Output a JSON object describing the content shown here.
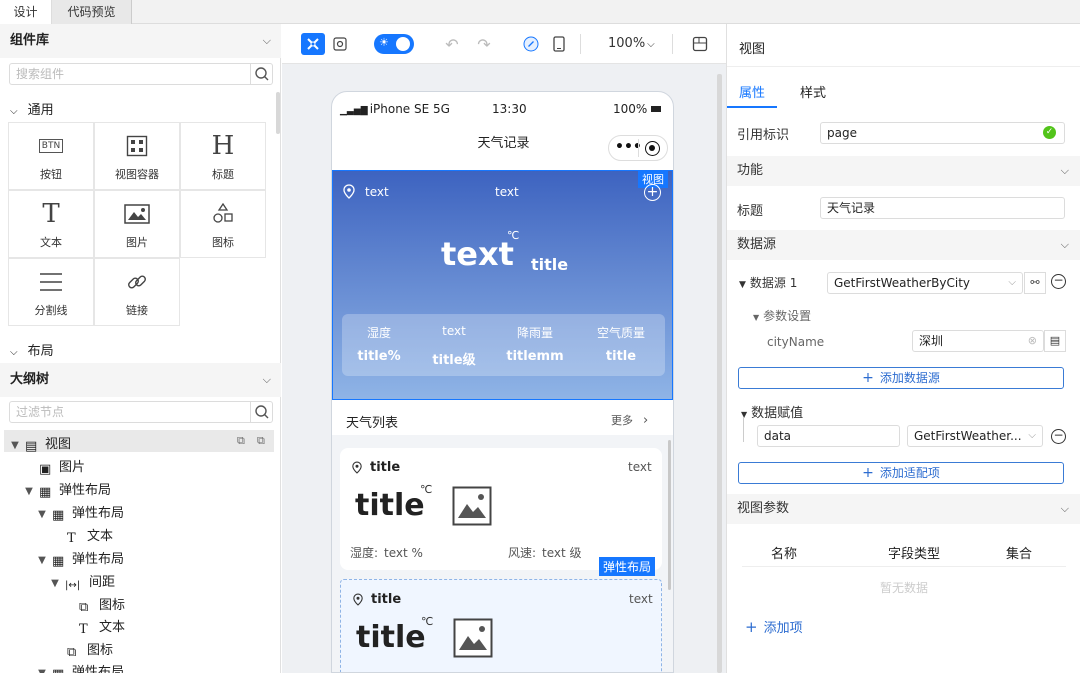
{
  "tabs": [
    {
      "label": "设计"
    },
    {
      "label": "代码预览"
    }
  ],
  "component_lib": {
    "title": "组件库",
    "search_placeholder": "搜索组件",
    "group_common": "通用",
    "group_layout": "布局",
    "items": [
      {
        "label": "按钮",
        "icon": "button-icon",
        "glyph": "BTN"
      },
      {
        "label": "视图容器",
        "icon": "view-container-icon",
        "glyph": "⊞"
      },
      {
        "label": "标题",
        "icon": "heading-icon",
        "glyph": "H"
      },
      {
        "label": "文本",
        "icon": "text-icon",
        "glyph": "T"
      },
      {
        "label": "图片",
        "icon": "image-icon",
        "glyph": "▣"
      },
      {
        "label": "图标",
        "icon": "shapes-icon",
        "glyph": "⧉"
      },
      {
        "label": "分割线",
        "icon": "divider-icon",
        "glyph": "☰"
      },
      {
        "label": "链接",
        "icon": "link-icon",
        "glyph": "🔗"
      }
    ]
  },
  "outline": {
    "title": "大纲树",
    "filter_placeholder": "过滤节点",
    "nodes": [
      {
        "label": "视图",
        "arrow": "▼",
        "glyph": "▤",
        "icon": "view-node-icon"
      },
      {
        "label": "图片",
        "arrow": "",
        "glyph": "▣",
        "icon": "image-node-icon"
      },
      {
        "label": "弹性布局",
        "arrow": "▼",
        "glyph": "▦",
        "icon": "flex-node-icon"
      },
      {
        "label": "弹性布局",
        "arrow": "▼",
        "glyph": "▦",
        "icon": "flex-node-icon"
      },
      {
        "label": "文本",
        "arrow": "",
        "glyph": "T",
        "icon": "text-node-icon"
      },
      {
        "label": "弹性布局",
        "arrow": "▼",
        "glyph": "▦",
        "icon": "flex-node-icon"
      },
      {
        "label": "间距",
        "arrow": "▼",
        "glyph": "|↔|",
        "icon": "spacing-node-icon"
      },
      {
        "label": "图标",
        "arrow": "",
        "glyph": "⧉",
        "icon": "icon-node-icon"
      },
      {
        "label": "文本",
        "arrow": "",
        "glyph": "T",
        "icon": "text-node-icon"
      },
      {
        "label": "图标",
        "arrow": "",
        "glyph": "⧉",
        "icon": "icon-node-icon"
      },
      {
        "label": "弹性布局",
        "arrow": "▼",
        "glyph": "▦",
        "icon": "flex-node-icon"
      }
    ]
  },
  "toolbar": {
    "zoom": "100%"
  },
  "phone": {
    "carrier": "iPhone SE 5G",
    "time": "13:30",
    "battery": "100%",
    "nav_title": "天气记录",
    "view_badge": "视图",
    "hero": {
      "location": "text",
      "top_center": "text",
      "temp": "text",
      "unit": "℃",
      "desc": "title"
    },
    "stats": [
      {
        "label": "湿度",
        "value": "title%"
      },
      {
        "label": "text",
        "value": "title级"
      },
      {
        "label": "降雨量",
        "value": "titlemm"
      },
      {
        "label": "空气质量",
        "value": "title"
      }
    ],
    "list_title": "天气列表",
    "more": "更多",
    "cards": [
      {
        "title": "title",
        "right": "text",
        "temp": "title",
        "unit": "℃",
        "humidity_label": "湿度:",
        "humidity_value": "text %",
        "wind_label": "风速:",
        "wind_value": "text 级",
        "badge": "弹性布局"
      },
      {
        "title": "title",
        "right": "text",
        "temp": "title",
        "unit": "℃"
      }
    ]
  },
  "panel": {
    "header": "视图",
    "tabs": [
      "属性",
      "样式"
    ],
    "ref_label": "引用标识",
    "ref_value": "page",
    "section_function": "功能",
    "title_label": "标题",
    "title_value": "天气记录",
    "section_datasource": "数据源",
    "datasource_label": "数据源 1",
    "datasource_value": "GetFirstWeatherByCity",
    "params_label": "参数设置",
    "param_name": "cityName",
    "param_value": "深圳",
    "add_datasource": "添加数据源",
    "assign_label": "数据赋值",
    "assign_key": "data",
    "assign_value": "GetFirstWeather...",
    "add_mapping": "添加适配项",
    "section_viewparams": "视图参数",
    "col_name": "名称",
    "col_type": "字段类型",
    "col_set": "集合",
    "empty": "暂无数据",
    "add_item": "添加项"
  },
  "colors": {
    "accent": "#1677ff",
    "hero_top": "#3d63c0",
    "hero_bottom": "#8fb4e6",
    "success": "#52c41a"
  }
}
